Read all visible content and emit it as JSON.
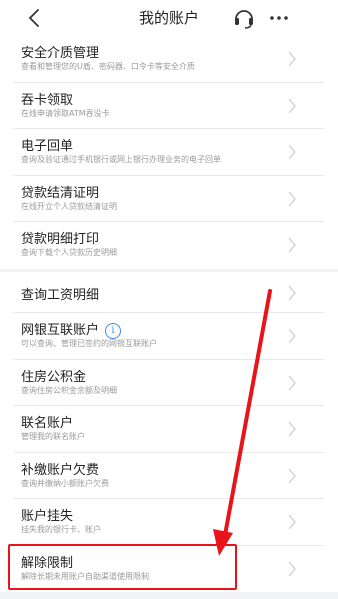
{
  "header": {
    "title": "我的账户",
    "icons": [
      "back-arrow-icon",
      "customer-service-headset-icon",
      "more-dots-icon"
    ]
  },
  "group1": [
    {
      "title": "安全介质管理",
      "subtitle": "查看和管理您的U盾、密码器、口令卡等安全介质"
    },
    {
      "title": "吞卡领取",
      "subtitle": "在线申请领取ATM吞没卡"
    },
    {
      "title": "电子回单",
      "subtitle": "查询及验证通过手机银行或网上银行办理业务的电子回单"
    },
    {
      "title": "贷款结清证明",
      "subtitle": "在线开立个人贷款结清证明"
    },
    {
      "title": "贷款明细打印",
      "subtitle": "查询下载个人贷款历史明细"
    }
  ],
  "group2": [
    {
      "title": "查询工资明细",
      "subtitle": ""
    },
    {
      "title": "网银互联账户",
      "subtitle": "可以查询、管理已签约的网银互联账户",
      "info_icon": "i"
    },
    {
      "title": "住房公积金",
      "subtitle": "查询住房公积金余额及明细"
    },
    {
      "title": "联名账户",
      "subtitle": "管理我的联名账户"
    },
    {
      "title": "补缴账户欠费",
      "subtitle": "查询并缴纳小额账户欠费"
    },
    {
      "title": "账户挂失",
      "subtitle": "挂失我的银行卡、账户"
    },
    {
      "title": "解除限制",
      "subtitle": "解除长期未用账户自助渠道使用限制"
    }
  ],
  "annotation": {
    "highlight_color": "#e8141a"
  }
}
